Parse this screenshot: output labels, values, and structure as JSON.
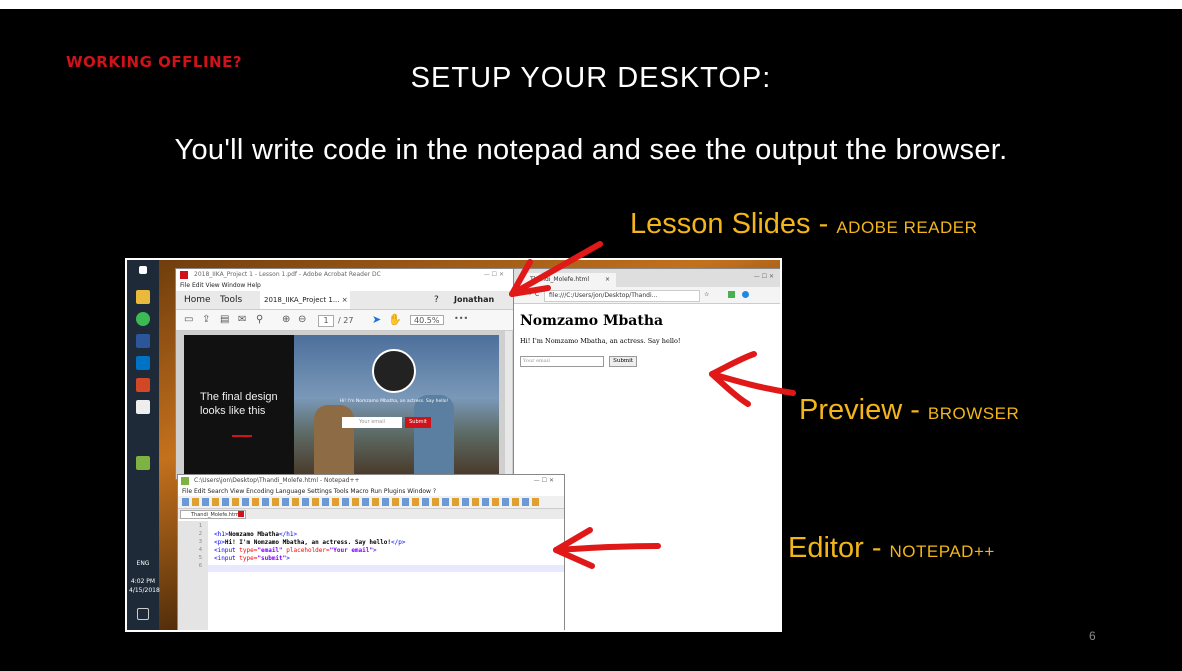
{
  "slide": {
    "kicker": "WORKING OFFLINE?",
    "title": "SETUP YOUR DESKTOP:",
    "subtitle": "You'll write code in the notepad and see the output the browser.",
    "page_number": "6",
    "labels": {
      "lesson": {
        "main": "Lesson Slides - ",
        "sub": "ADOBE READER"
      },
      "preview": {
        "main": "Preview - ",
        "sub": "BROWSER"
      },
      "editor": {
        "main": "Editor - ",
        "sub": "NOTEPAD++"
      }
    }
  },
  "taskbar": {
    "lang": "ENG",
    "time": "4:02 PM",
    "date": "4/15/2018"
  },
  "adobe": {
    "title": "2018_IIKA_Project 1 - Lesson 1.pdf - Adobe Acrobat Reader DC",
    "menu": "File  Edit  View  Window  Help",
    "nav_home": "Home",
    "nav_tools": "Tools",
    "doc_tab": "2018_IIKA_Project 1...  ×",
    "user": "Jonathan",
    "page_current": "1",
    "page_total": "/ 27",
    "zoom": "40.5%",
    "slide_caption": "The final design looks like this",
    "slide_hi": "Hi! I'm Nomzamo Mbatha, an actress. Say hello!",
    "slide_email": "Your email",
    "slide_submit": "Submit"
  },
  "browser": {
    "tab_title": "Thandi_Molefe.html",
    "tab_close": "×",
    "url": "file:///C:/Users/jon/Desktop/Thandi...",
    "heading": "Nomzamo Mbatha",
    "paragraph": "Hi! I'm Nomzamo Mbatha, an actress. Say hello!",
    "input_placeholder": "Your email",
    "submit": "Submit"
  },
  "notepad": {
    "title": "C:\\Users\\jon\\Desktop\\Thandi_Molefe.html - Notepad++",
    "menu": "File  Edit  Search  View  Encoding  Language  Settings  Tools  Macro  Run  Plugins  Window  ?",
    "tab": "Thandi_Molefe.html",
    "line_numbers": [
      "1",
      "2",
      "3",
      "4",
      "5",
      "6"
    ],
    "code": {
      "l2_open": "<h1>",
      "l2_text": "Nomzamo Mbatha",
      "l2_close": "</h1>",
      "l3_open": "<p>",
      "l3_text": "Hi! I'm Nomzamo Mbatha, an actress. Say hello!",
      "l3_close": "</p>",
      "l4_tag": "<input",
      "l4_a1": " type=",
      "l4_v1": "\"email\"",
      "l4_a2": " placeholder=",
      "l4_v2": "\"Your email\"",
      "l4_end": ">",
      "l5_tag": "<input",
      "l5_a1": " type=",
      "l5_v1": "\"submit\"",
      "l5_end": ">"
    }
  },
  "colors": {
    "kicker": "#d0121b",
    "label": "#f2b51a",
    "arrow": "#e01818"
  }
}
